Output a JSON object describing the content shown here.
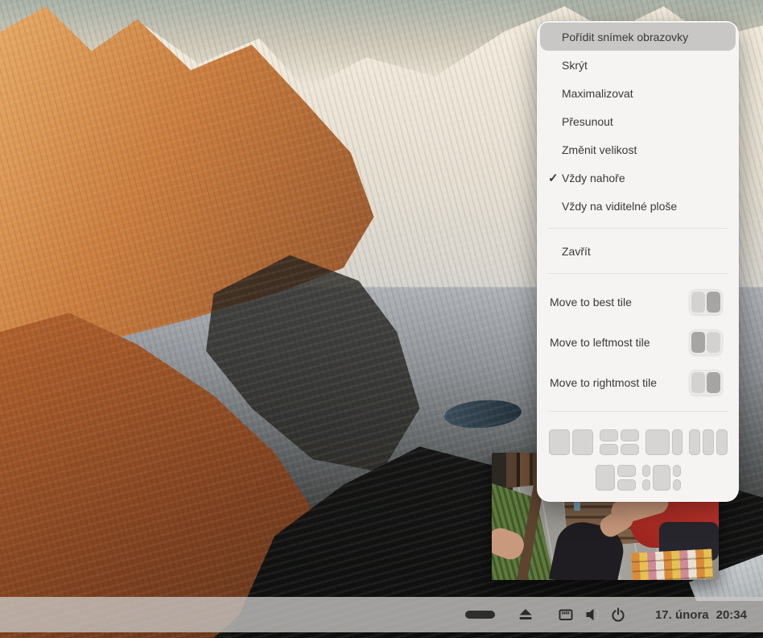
{
  "context_menu": {
    "items": [
      {
        "label": "Pořídit snímek obrazovky",
        "state": "highlighted"
      },
      {
        "label": "Skrýt"
      },
      {
        "label": "Maximalizovat"
      },
      {
        "label": "Přesunout"
      },
      {
        "label": "Změnit velikost"
      },
      {
        "label": "Vždy nahoře",
        "checked": true
      },
      {
        "label": "Vždy na viditelné ploše"
      },
      {
        "label": "Zavřít"
      }
    ],
    "tile_actions": [
      {
        "label": "Move to best tile",
        "active": "right"
      },
      {
        "label": "Move to leftmost tile",
        "active": "left"
      },
      {
        "label": "Move to rightmost tile",
        "active": "right"
      }
    ],
    "tile_layouts": [
      "two-columns",
      "quad-grid",
      "wide-left-narrow-right",
      "three-columns",
      "left-plus-stacked-right",
      "side-stacks-center"
    ],
    "checkmark_glyph": "✓"
  },
  "taskbar": {
    "icons": [
      "window-pill",
      "eject",
      "ethernet",
      "volume",
      "power"
    ],
    "date": "17. února",
    "time": "20:34"
  },
  "colors": {
    "menu_bg": "#f5f4f2",
    "menu_highlight": "#c9c7c5",
    "menu_text": "#3a3937",
    "separator": "#e3e1df",
    "toggle_bg": "#eceae8",
    "toggle_light": "#d3d2d0",
    "toggle_dark": "#a7a5a3",
    "tile_glyph": "#d7d5d3",
    "taskbar_bg": "rgba(201,200,197,0.78)",
    "taskbar_icon": "#2b2b2a",
    "alpenglow": "#cb7e3f",
    "sky": "#a9b2a8"
  }
}
